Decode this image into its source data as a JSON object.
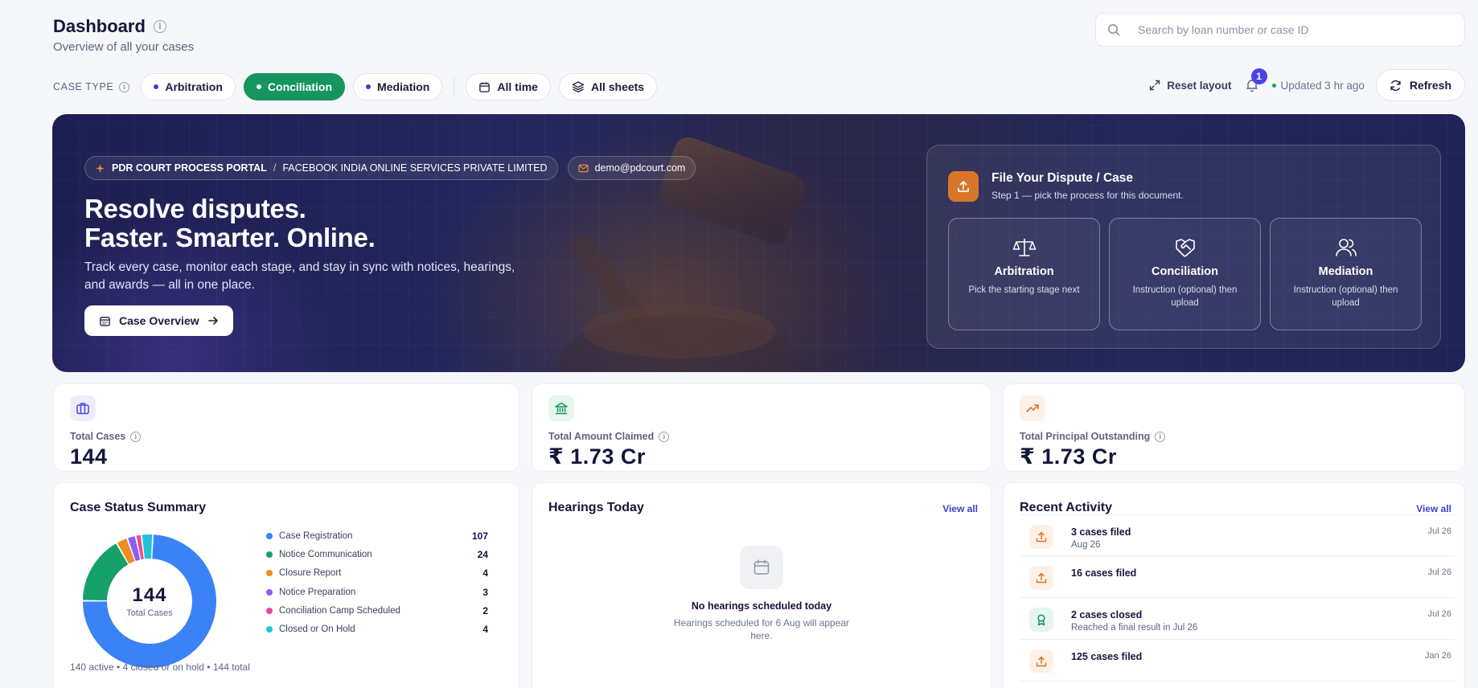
{
  "header": {
    "title": "Dashboard",
    "subtitle": "Overview of all your cases",
    "search_placeholder": "Search by loan number or case ID"
  },
  "filters": {
    "case_type_label": "CASE TYPE",
    "case_types": [
      {
        "label": "Arbitration",
        "active": false
      },
      {
        "label": "Conciliation",
        "active": true
      },
      {
        "label": "Mediation",
        "active": false
      }
    ],
    "time_label": "All time",
    "sheets_label": "All sheets"
  },
  "toolbar": {
    "reset_label": "Reset layout",
    "notification_count": "1",
    "updated_label": "Updated 3 hr ago",
    "refresh_label": "Refresh"
  },
  "hero": {
    "portal": "PDR COURT PROCESS PORTAL",
    "org": "FACEBOOK INDIA ONLINE SERVICES PRIVATE LIMITED",
    "email": "demo@pdcourt.com",
    "title_line1": "Resolve disputes.",
    "title_line2": "Faster. Smarter. Online.",
    "description": "Track every case, monitor each stage, and stay in sync with notices, hearings, and awards — all in one place.",
    "cta_label": "Case Overview",
    "file_card": {
      "title": "File Your Dispute / Case",
      "subtitle": "Step 1 — pick the process for this document.",
      "processes": [
        {
          "title": "Arbitration",
          "desc": "Pick the starting stage next",
          "icon": "scales-icon"
        },
        {
          "title": "Conciliation",
          "desc": "Instruction (optional) then upload",
          "icon": "handshake-icon"
        },
        {
          "title": "Mediation",
          "desc": "Instruction (optional) then upload",
          "icon": "users-icon"
        }
      ]
    }
  },
  "stats": [
    {
      "label": "Total Cases",
      "value": "144",
      "icon": "briefcase-icon",
      "color": "#4b44e6",
      "bg": "#eeedfc"
    },
    {
      "label": "Total Amount Claimed",
      "value": "₹ 1.73 Cr",
      "icon": "bank-icon",
      "color": "#16955f",
      "bg": "#e6f5ee"
    },
    {
      "label": "Total Principal Outstanding",
      "value": "₹ 1.73 Cr",
      "icon": "trending-up-icon",
      "color": "#d8752b",
      "bg": "#fdf1e7"
    }
  ],
  "status_summary": {
    "title": "Case Status Summary",
    "center_value": "144",
    "center_label": "Total Cases",
    "items": [
      {
        "label": "Case Registration",
        "value": 107,
        "color": "#3b82f6"
      },
      {
        "label": "Notice Communication",
        "value": 24,
        "color": "#16a06a"
      },
      {
        "label": "Closure Report",
        "value": 4,
        "color": "#f08a24"
      },
      {
        "label": "Notice Preparation",
        "value": 3,
        "color": "#8b5cf6"
      },
      {
        "label": "Conciliation Camp Scheduled",
        "value": 2,
        "color": "#ec4899"
      },
      {
        "label": "Closed or On Hold",
        "value": 4,
        "color": "#22c3d8"
      }
    ],
    "footer": "140 active • 4 closed or on hold • 144 total"
  },
  "hearings": {
    "title": "Hearings Today",
    "view_all": "View all",
    "empty_title": "No hearings scheduled today",
    "empty_sub": "Hearings scheduled for 6 Aug will appear here."
  },
  "activity": {
    "title": "Recent Activity",
    "view_all": "View all",
    "items": [
      {
        "title": "3 cases filed",
        "sub": "Aug 26",
        "date": "Jul 26",
        "icon": "upload-icon",
        "color": "#d8752b",
        "bg": "#fdf1e7"
      },
      {
        "title": "16 cases filed",
        "sub": "",
        "date": "Jul 26",
        "icon": "upload-icon",
        "color": "#d8752b",
        "bg": "#fdf1e7"
      },
      {
        "title": "2 cases closed",
        "sub": "Reached a final result in Jul 26",
        "date": "Jul 26",
        "icon": "award-icon",
        "color": "#16955f",
        "bg": "#e6f5ee"
      },
      {
        "title": "125 cases filed",
        "sub": "",
        "date": "Jan 26",
        "icon": "upload-icon",
        "color": "#d8752b",
        "bg": "#fdf1e7"
      }
    ]
  }
}
